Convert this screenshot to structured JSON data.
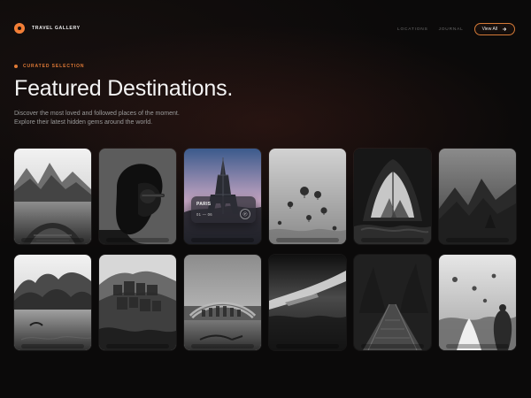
{
  "header": {
    "brand": "TRAVEL GALLERY",
    "nav": [
      "LOCATIONS",
      "JOURNAL"
    ],
    "cta": "View All"
  },
  "hero": {
    "eyebrow": "CURATED SELECTION",
    "title": "Featured Destinations.",
    "subtitle_lines": [
      "Discover the most loved and followed places of the moment.",
      "Explore their latest hidden gems around the world."
    ]
  },
  "featured_card": {
    "label": "PARIS",
    "meta": "01 — 06"
  },
  "gallery": {
    "rows": [
      [
        "lake-boat",
        "portrait-woman",
        "paris-eiffel",
        "hot-air-balloons",
        "tent-view",
        "mountains"
      ],
      [
        "coastal-cliffs",
        "cliff-village",
        "venice-bridge",
        "airplane-wing",
        "forest-bridge",
        "balloons-field"
      ]
    ]
  },
  "colors": {
    "accent": "#e07a36",
    "background": "#0b0a0a"
  }
}
